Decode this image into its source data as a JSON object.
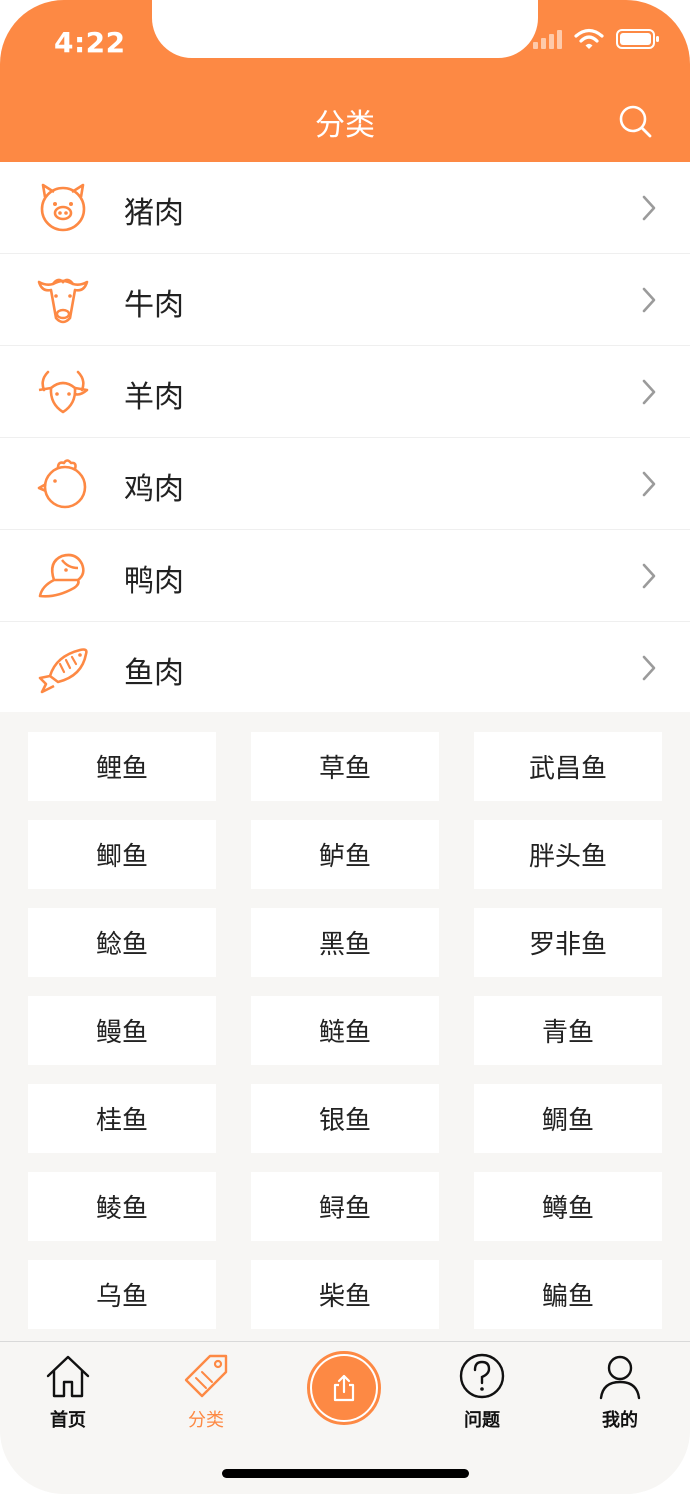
{
  "status_bar": {
    "time": "4:22"
  },
  "header": {
    "title": "分类",
    "search_icon": "search-icon"
  },
  "categories": [
    {
      "label": "猪肉",
      "icon": "pig-icon"
    },
    {
      "label": "牛肉",
      "icon": "cow-icon"
    },
    {
      "label": "羊肉",
      "icon": "goat-icon"
    },
    {
      "label": "鸡肉",
      "icon": "chicken-icon"
    },
    {
      "label": "鸭肉",
      "icon": "duck-icon"
    },
    {
      "label": "鱼肉",
      "icon": "fish-icon"
    }
  ],
  "subcategories": [
    "鲤鱼",
    "草鱼",
    "武昌鱼",
    "鲫鱼",
    "鲈鱼",
    "胖头鱼",
    "鲶鱼",
    "黑鱼",
    "罗非鱼",
    "鳗鱼",
    "鲢鱼",
    "青鱼",
    "桂鱼",
    "银鱼",
    "鲷鱼",
    "鲮鱼",
    "鲟鱼",
    "鳟鱼",
    "乌鱼",
    "柴鱼",
    "鳊鱼"
  ],
  "tabbar": {
    "items": [
      {
        "label": "首页",
        "icon": "home-icon",
        "active": false
      },
      {
        "label": "分类",
        "icon": "tag-icon",
        "active": true
      },
      {
        "label": "",
        "icon": "upload-icon",
        "active": false
      },
      {
        "label": "问题",
        "icon": "question-icon",
        "active": false
      },
      {
        "label": "我的",
        "icon": "user-icon",
        "active": false
      }
    ]
  },
  "colors": {
    "accent": "#fd8944",
    "background": "#f7f6f4",
    "text": "#222222"
  }
}
